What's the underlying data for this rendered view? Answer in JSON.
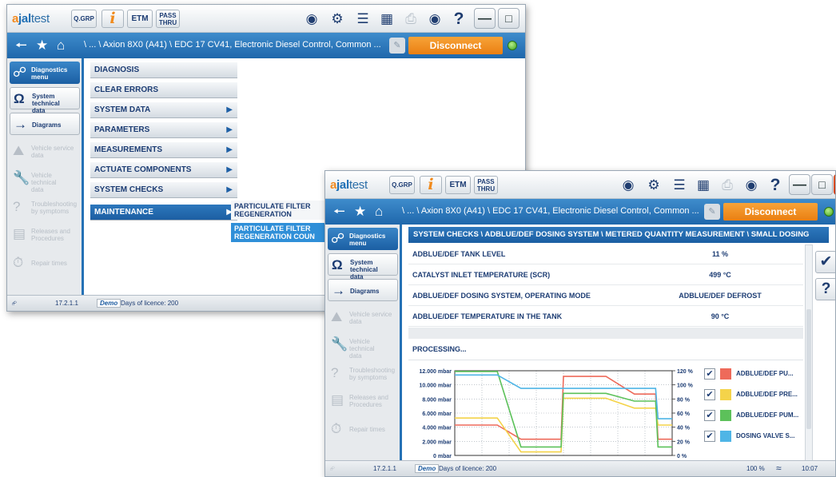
{
  "colors": {
    "accent": "#1f67ab",
    "disconnect": "#ea7f12",
    "close": "#e0401e",
    "series": [
      "#ee6a5a",
      "#f4d34a",
      "#5cc15a",
      "#4fb5e6"
    ]
  },
  "app": {
    "logo_prefix": "a",
    "logo_main": "jal",
    "logo_suffix": "test"
  },
  "toolbar": {
    "grp": "Q.GRP",
    "info": "i",
    "etm": "ETM",
    "pass1": "PASS",
    "pass2": "THRU",
    "help": "?"
  },
  "icons": [
    "globe-icon",
    "eye-gear-icon",
    "list-icon",
    "calendar-icon",
    "printer-icon",
    "camera-icon",
    "help-icon",
    "back-arrow-icon",
    "star-icon",
    "home-icon",
    "edit-icon",
    "status-led-icon",
    "usb-icon",
    "check-icon"
  ],
  "window1": {
    "breadcrumb": "\\ ... \\ Axion 8X0 (A41) \\ EDC 17 CV41, Electronic Diesel Control, Common ...",
    "disconnect": "Disconnect",
    "menu": [
      {
        "label": "DIAGNOSIS",
        "arrow": ""
      },
      {
        "label": "CLEAR ERRORS",
        "arrow": ""
      },
      {
        "label": "SYSTEM DATA",
        "arrow": "▶"
      },
      {
        "label": "PARAMETERS",
        "arrow": "▶"
      },
      {
        "label": "MEASUREMENTS",
        "arrow": "▶"
      },
      {
        "label": "ACTUATE COMPONENTS",
        "arrow": "▶"
      },
      {
        "label": "SYSTEM CHECKS",
        "arrow": "▶"
      },
      {
        "label": "MAINTENANCE",
        "arrow": "▶"
      }
    ],
    "submenu": [
      "PARTICULATE FILTER",
      "REGENERATION",
      "PARTICULATE FILTER",
      "REGENERATION COUN"
    ],
    "status": {
      "version": "17.2.1.1",
      "demo": "Demo",
      "licence": "Days of licence: 200"
    }
  },
  "sidebar": [
    {
      "label1": "Diagnostics",
      "label2": "menu"
    },
    {
      "label1": "System technical",
      "label2": "data"
    },
    {
      "label1": "Diagrams",
      "label2": ""
    },
    {
      "label1": "Vehicle service",
      "label2": "data"
    },
    {
      "label1": "Vehicle technical",
      "label2": "data"
    },
    {
      "label1": "Troubleshooting",
      "label2": "by symptoms"
    },
    {
      "label1": "Releases and",
      "label2": "Procedures"
    },
    {
      "label1": "Repair times",
      "label2": ""
    }
  ],
  "window2": {
    "breadcrumb": "\\ ... \\ Axion 8X0 (A41) \\ EDC 17 CV41, Electronic Diesel Control, Common ...",
    "disconnect": "Disconnect",
    "crumb": "SYSTEM CHECKS \\ ADBLUE/DEF DOSING SYSTEM \\ METERED QUANTITY MEASUREMENT \\ SMALL DOSING",
    "rows": [
      {
        "label": "ADBLUE/DEF TANK LEVEL",
        "value": "11 %"
      },
      {
        "label": "CATALYST INLET TEMPERATURE (SCR)",
        "value": "499 °C"
      },
      {
        "label": "ADBLUE/DEF DOSING SYSTEM, OPERATING MODE",
        "value": "ADBLUE/DEF DEFROST"
      },
      {
        "label": "ADBLUE/DEF TEMPERATURE IN THE TANK",
        "value": "90 °C"
      }
    ],
    "processing": "PROCESSING...",
    "status": {
      "version": "17.2.1.1",
      "demo": "Demo",
      "licence": "Days of licence: 200",
      "zoom": "100 %",
      "time": "10:07"
    }
  },
  "chart_data": {
    "type": "line",
    "title": "",
    "yleft": {
      "ticks": [
        "12.000 mbar",
        "10.000 mbar",
        "8.000 mbar",
        "6.000 mbar",
        "4.000 mbar",
        "2.000 mbar",
        "0 mbar"
      ],
      "range": [
        0,
        12000
      ]
    },
    "yright": {
      "ticks": [
        "120 %",
        "100 %",
        "80 %",
        "60 %",
        "40 %",
        "20 %",
        "0 %"
      ],
      "range": [
        0,
        120
      ]
    },
    "x": [
      0,
      1,
      1.8,
      2.8,
      3.6,
      4.0,
      4.5,
      4.6,
      5.6,
      6.4,
      7.6,
      8.5,
      8.6,
      9.2
    ],
    "series": [
      {
        "name": "ADBLUE/DEF PU...",
        "values": [
          4300,
          4300,
          4300,
          2300,
          2300,
          2300,
          2300,
          11200,
          11200,
          11200,
          8700,
          8700,
          2300,
          2300
        ]
      },
      {
        "name": "ADBLUE/DEF PRE...",
        "values": [
          5300,
          5300,
          5300,
          500,
          500,
          500,
          500,
          8100,
          8100,
          8100,
          6700,
          6700,
          4300,
          4300
        ]
      },
      {
        "name": "ADBLUE/DEF PUM...",
        "values": [
          11900,
          11900,
          11900,
          1200,
          1200,
          1200,
          1200,
          8800,
          8800,
          8800,
          7700,
          7700,
          1200,
          1200
        ]
      },
      {
        "name": "DOSING VALVE S...",
        "values": [
          11400,
          11400,
          11400,
          9500,
          9500,
          9500,
          9500,
          9500,
          9500,
          9500,
          9500,
          9500,
          5200,
          5200
        ]
      }
    ]
  }
}
